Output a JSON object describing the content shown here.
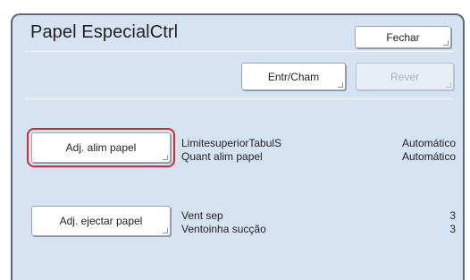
{
  "header": {
    "title": "Papel EspecialCtrl",
    "close_label": "Fechar"
  },
  "toolbar": {
    "entr_cham_label": "Entr/Cham",
    "rever_label": "Rever"
  },
  "sections": [
    {
      "button_label": "Adj. alim papel",
      "highlighted": true,
      "rows": [
        {
          "label": "LimitesuperiorTabulS",
          "value": "Automático"
        },
        {
          "label": "Quant alim papel",
          "value": "Automático"
        }
      ]
    },
    {
      "button_label": "Adj. ejectar papel",
      "highlighted": false,
      "rows": [
        {
          "label": "Vent sep",
          "value": "3"
        },
        {
          "label": "Ventoinha sucção",
          "value": "3"
        }
      ]
    }
  ],
  "colors": {
    "panel_background": "#d6e3f2",
    "highlight_border": "#d42a2a",
    "disabled_text": "#a8b2bf"
  }
}
